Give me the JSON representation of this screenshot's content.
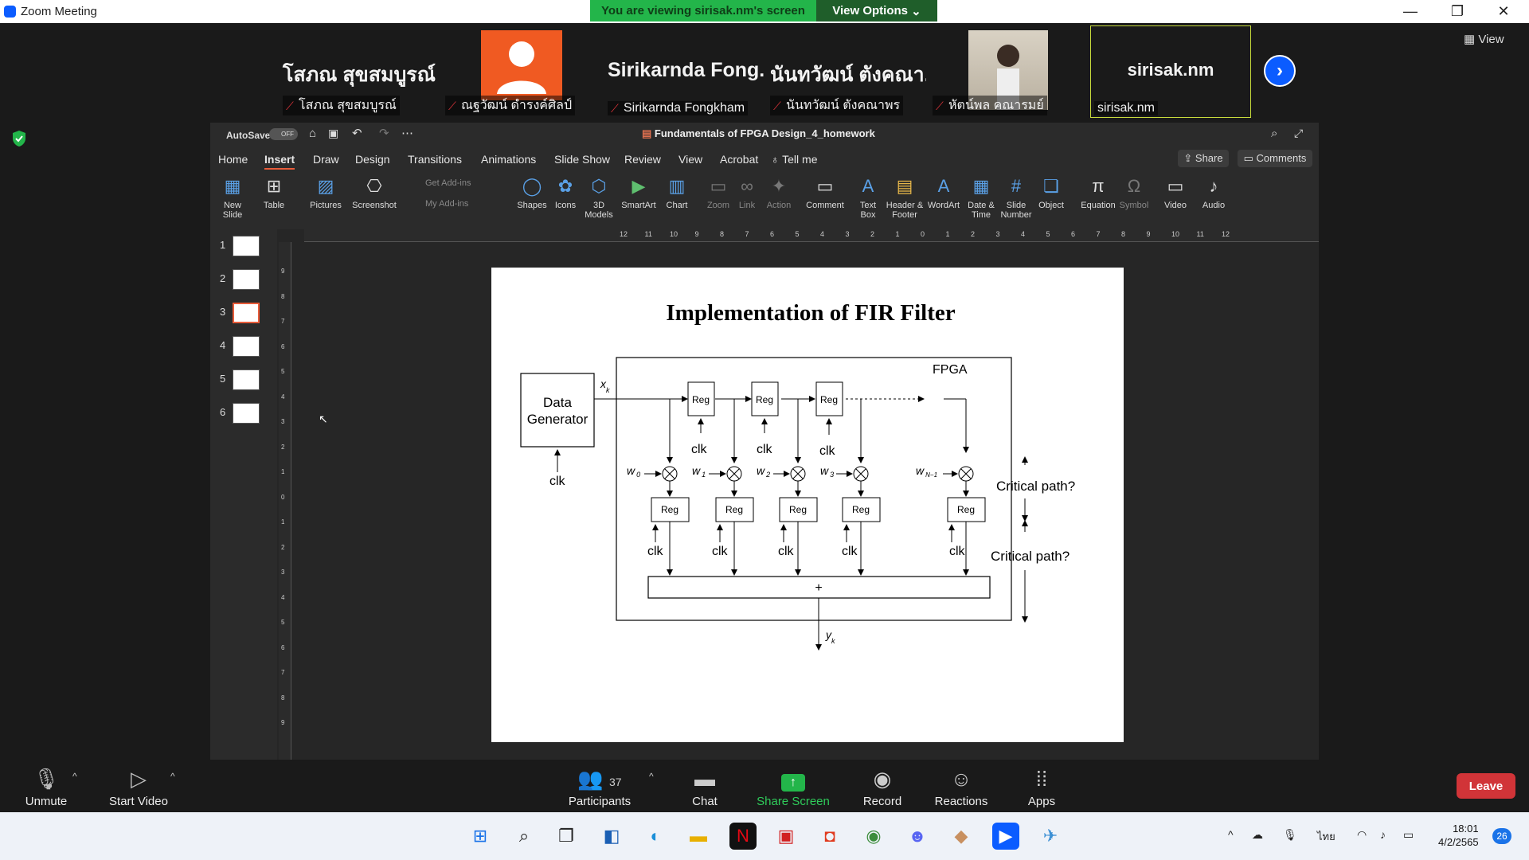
{
  "window": {
    "title": "Zoom Meeting"
  },
  "banner": {
    "viewing": "You are viewing sirisak.nm's screen",
    "view_options": "View Options"
  },
  "view_label": "View",
  "participants_strip": [
    {
      "big": "โสภณ สุขสมบูรณ์",
      "name": "โสภณ สุขสมบูรณ์",
      "muted": true
    },
    {
      "big": "",
      "name": "ณฐวัฒน์ ดำรงค์ศิลป์",
      "muted": true
    },
    {
      "big": "Sirikarnda Fong...",
      "name": "Sirikarnda Fongkham",
      "muted": true
    },
    {
      "big": "นันทวัฒน์ ตังคณา...",
      "name": "นันทวัฒน์ ตังคณาพร",
      "muted": true
    },
    {
      "big": "",
      "name": "หัตน์พล คณารมย์",
      "muted": true
    },
    {
      "big": "sirisak.nm",
      "name": "sirisak.nm",
      "muted": false
    }
  ],
  "ppt": {
    "autosave": "AutoSave",
    "autosave_state": "OFF",
    "doc_title": "Fundamentals of FPGA Design_4_homework",
    "menu": [
      "Home",
      "Insert",
      "Draw",
      "Design",
      "Transitions",
      "Animations",
      "Slide Show",
      "Review",
      "View",
      "Acrobat",
      "Tell me"
    ],
    "share": "Share",
    "comments": "Comments",
    "ribbon": {
      "new_slide": "New Slide",
      "table": "Table",
      "pictures": "Pictures",
      "screenshot": "Screenshot",
      "get_addins": "Get Add-ins",
      "my_addins": "My Add-ins",
      "shapes": "Shapes",
      "icons": "Icons",
      "models": "3D Models",
      "smartart": "SmartArt",
      "chart": "Chart",
      "zoom": "Zoom",
      "link": "Link",
      "action": "Action",
      "comment": "Comment",
      "textbox": "Text Box",
      "header_footer": "Header & Footer",
      "wordart": "WordArt",
      "date_time": "Date & Time",
      "slide_number": "Slide Number",
      "object": "Object",
      "equation": "Equation",
      "symbol": "Symbol",
      "video": "Video",
      "audio": "Audio"
    },
    "slide_numbers": [
      "1",
      "2",
      "3",
      "4",
      "5",
      "6"
    ],
    "ruler_h": [
      "12",
      "11",
      "10",
      "9",
      "8",
      "7",
      "6",
      "5",
      "4",
      "3",
      "2",
      "1",
      "0",
      "1",
      "2",
      "3",
      "4",
      "5",
      "6",
      "7",
      "8",
      "9",
      "10",
      "11",
      "12"
    ],
    "ruler_v": [
      "9",
      "8",
      "7",
      "6",
      "5",
      "4",
      "3",
      "2",
      "1",
      "0",
      "1",
      "2",
      "3",
      "4",
      "5",
      "6",
      "7",
      "8",
      "9"
    ]
  },
  "slide": {
    "title": "Implementation of FIR Filter",
    "fpga": "FPGA",
    "data_gen_1": "Data",
    "data_gen_2": "Generator",
    "clk": "clk",
    "reg": "Reg",
    "plus": "+",
    "xk": "x",
    "xk_sub": "k",
    "yk": "y",
    "yk_sub": "k",
    "w": [
      "w",
      "w",
      "w",
      "w",
      "w"
    ],
    "w_sub": [
      "0",
      "1",
      "2",
      "3",
      "N−1"
    ],
    "critical1": "Critical path?",
    "critical2": "Critical path?"
  },
  "toolbar": {
    "unmute": "Unmute",
    "start_video": "Start Video",
    "participants": "Participants",
    "participants_count": "37",
    "chat": "Chat",
    "share_screen": "Share Screen",
    "record": "Record",
    "reactions": "Reactions",
    "apps": "Apps",
    "leave": "Leave"
  },
  "taskbar": {
    "time": "18:01",
    "date": "4/2/2565",
    "lang": "ไทย",
    "badge": "26"
  }
}
